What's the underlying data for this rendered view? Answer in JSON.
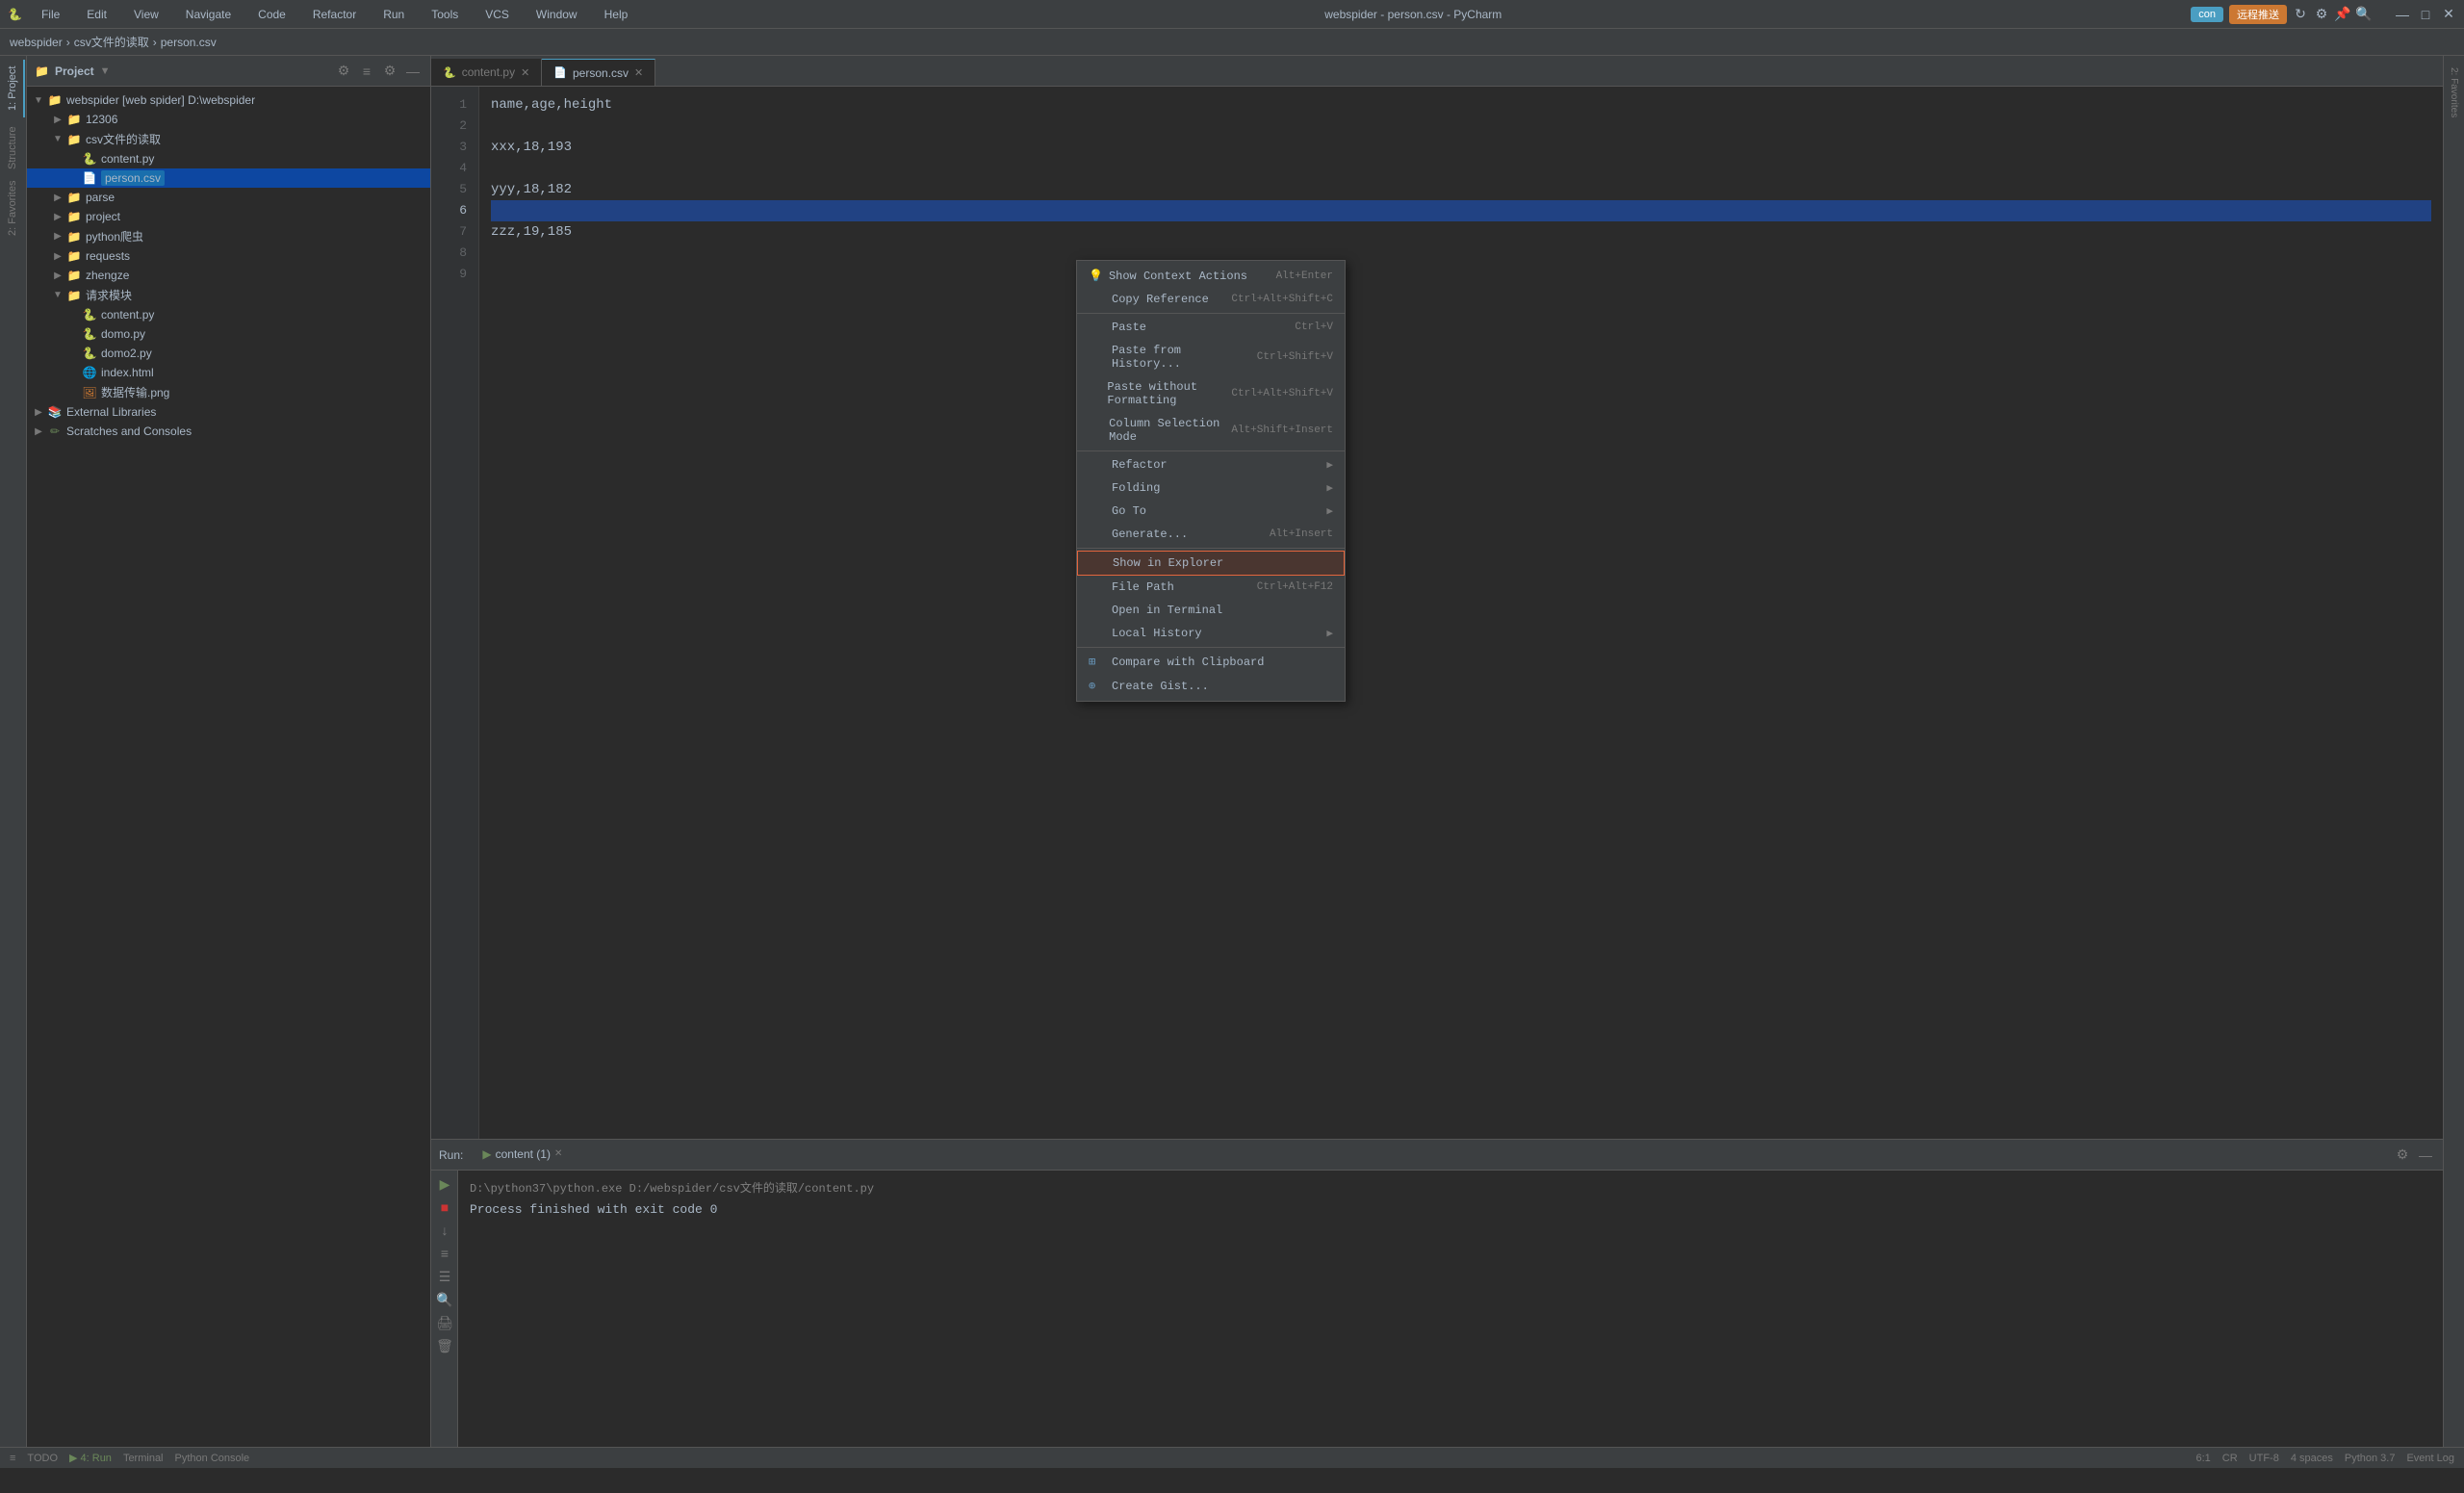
{
  "titlebar": {
    "title": "webspider - person.csv - PyCharm",
    "min_btn": "—",
    "max_btn": "□",
    "close_btn": "✕"
  },
  "menubar": {
    "items": [
      "File",
      "Edit",
      "View",
      "Navigate",
      "Code",
      "Refactor",
      "Run",
      "Tools",
      "VCS",
      "Window",
      "Help"
    ]
  },
  "breadcrumb": {
    "parts": [
      "webspider",
      ">",
      "csv文件的读取",
      ">",
      "person.csv"
    ]
  },
  "project_panel": {
    "title": "Project",
    "header_buttons": [
      "⚙",
      "≡",
      "⚙",
      "—"
    ],
    "tree": [
      {
        "indent": 0,
        "type": "folder",
        "expanded": true,
        "label": "webspider [web spider] D:\\webspider"
      },
      {
        "indent": 1,
        "type": "folder",
        "expanded": true,
        "label": "12306"
      },
      {
        "indent": 1,
        "type": "folder",
        "expanded": true,
        "label": "csv文件的读取"
      },
      {
        "indent": 2,
        "type": "py",
        "label": "content.py"
      },
      {
        "indent": 2,
        "type": "csv",
        "label": "person.csv",
        "selected": true
      },
      {
        "indent": 1,
        "type": "folder",
        "expanded": false,
        "label": "parse"
      },
      {
        "indent": 1,
        "type": "folder",
        "expanded": false,
        "label": "project"
      },
      {
        "indent": 1,
        "type": "folder",
        "expanded": false,
        "label": "python爬虫"
      },
      {
        "indent": 1,
        "type": "folder",
        "expanded": false,
        "label": "requests"
      },
      {
        "indent": 1,
        "type": "folder",
        "expanded": false,
        "label": "zhengze"
      },
      {
        "indent": 1,
        "type": "folder",
        "expanded": false,
        "label": "请求模块"
      },
      {
        "indent": 2,
        "type": "py",
        "label": "content.py"
      },
      {
        "indent": 2,
        "type": "py",
        "label": "domo.py"
      },
      {
        "indent": 2,
        "type": "py",
        "label": "domo2.py"
      },
      {
        "indent": 2,
        "type": "html",
        "label": "index.html"
      },
      {
        "indent": 2,
        "type": "png",
        "label": "数据传输.png"
      },
      {
        "indent": 0,
        "type": "folder",
        "expanded": false,
        "label": "External Libraries"
      },
      {
        "indent": 0,
        "type": "scratches",
        "label": "Scratches and Consoles"
      }
    ]
  },
  "editor": {
    "tabs": [
      {
        "label": "content.py",
        "active": false,
        "icon": "py"
      },
      {
        "label": "person.csv",
        "active": true,
        "icon": "csv"
      }
    ],
    "lines": [
      {
        "num": 1,
        "content": "name,age,height"
      },
      {
        "num": 2,
        "content": ""
      },
      {
        "num": 3,
        "content": "xxx,18,193"
      },
      {
        "num": 4,
        "content": ""
      },
      {
        "num": 5,
        "content": "yyy,18,182"
      },
      {
        "num": 6,
        "content": "",
        "active": true
      },
      {
        "num": 7,
        "content": "zzz,19,185"
      },
      {
        "num": 8,
        "content": ""
      },
      {
        "num": 9,
        "content": ""
      }
    ]
  },
  "context_menu": {
    "items": [
      {
        "label": "Show Context Actions",
        "shortcut": "Alt+Enter",
        "icon": "bulb",
        "has_arrow": false
      },
      {
        "label": "Copy Reference",
        "shortcut": "Ctrl+Alt+Shift+C",
        "has_arrow": false
      },
      {
        "label": "Paste",
        "shortcut": "Ctrl+V",
        "has_arrow": false
      },
      {
        "label": "Paste from History...",
        "shortcut": "Ctrl+Shift+V",
        "has_arrow": false
      },
      {
        "label": "Paste without Formatting",
        "shortcut": "Ctrl+Alt+Shift+V",
        "has_arrow": false
      },
      {
        "label": "Column Selection Mode",
        "shortcut": "Alt+Shift+Insert",
        "has_arrow": false
      },
      {
        "label": "Refactor",
        "has_arrow": true,
        "separator_after": true
      },
      {
        "label": "Folding",
        "has_arrow": true
      },
      {
        "label": "Go To",
        "has_arrow": true
      },
      {
        "label": "Generate...",
        "shortcut": "Alt+Insert",
        "has_arrow": false,
        "separator_after": true
      },
      {
        "label": "Show in Explorer",
        "highlighted": true,
        "has_arrow": false
      },
      {
        "label": "File Path",
        "shortcut": "Ctrl+Alt+F12",
        "has_arrow": false
      },
      {
        "label": "Open in Terminal",
        "has_arrow": false
      },
      {
        "label": "Local History",
        "has_arrow": true
      },
      {
        "label": "Compare with Clipboard",
        "icon": "compare",
        "has_arrow": false
      },
      {
        "label": "Create Gist...",
        "icon": "gist",
        "has_arrow": false
      }
    ]
  },
  "run_panel": {
    "tab_label": "Run:",
    "tab_name": "content (1)",
    "cmd": "D:\\python37\\python.exe D:/webspider/csv文件的读取/content.py",
    "output": "Process finished with exit code 0"
  },
  "statusbar": {
    "left": [
      "≡",
      "TODO",
      "▶ 4: Run",
      "Terminal",
      "Python Console"
    ],
    "right": [
      "6:1",
      "CR",
      "UTF-8",
      "4 spaces",
      "Python 3.7",
      "Event Log"
    ]
  },
  "top_right": {
    "badge1": "con",
    "badge2": "远程推送"
  }
}
